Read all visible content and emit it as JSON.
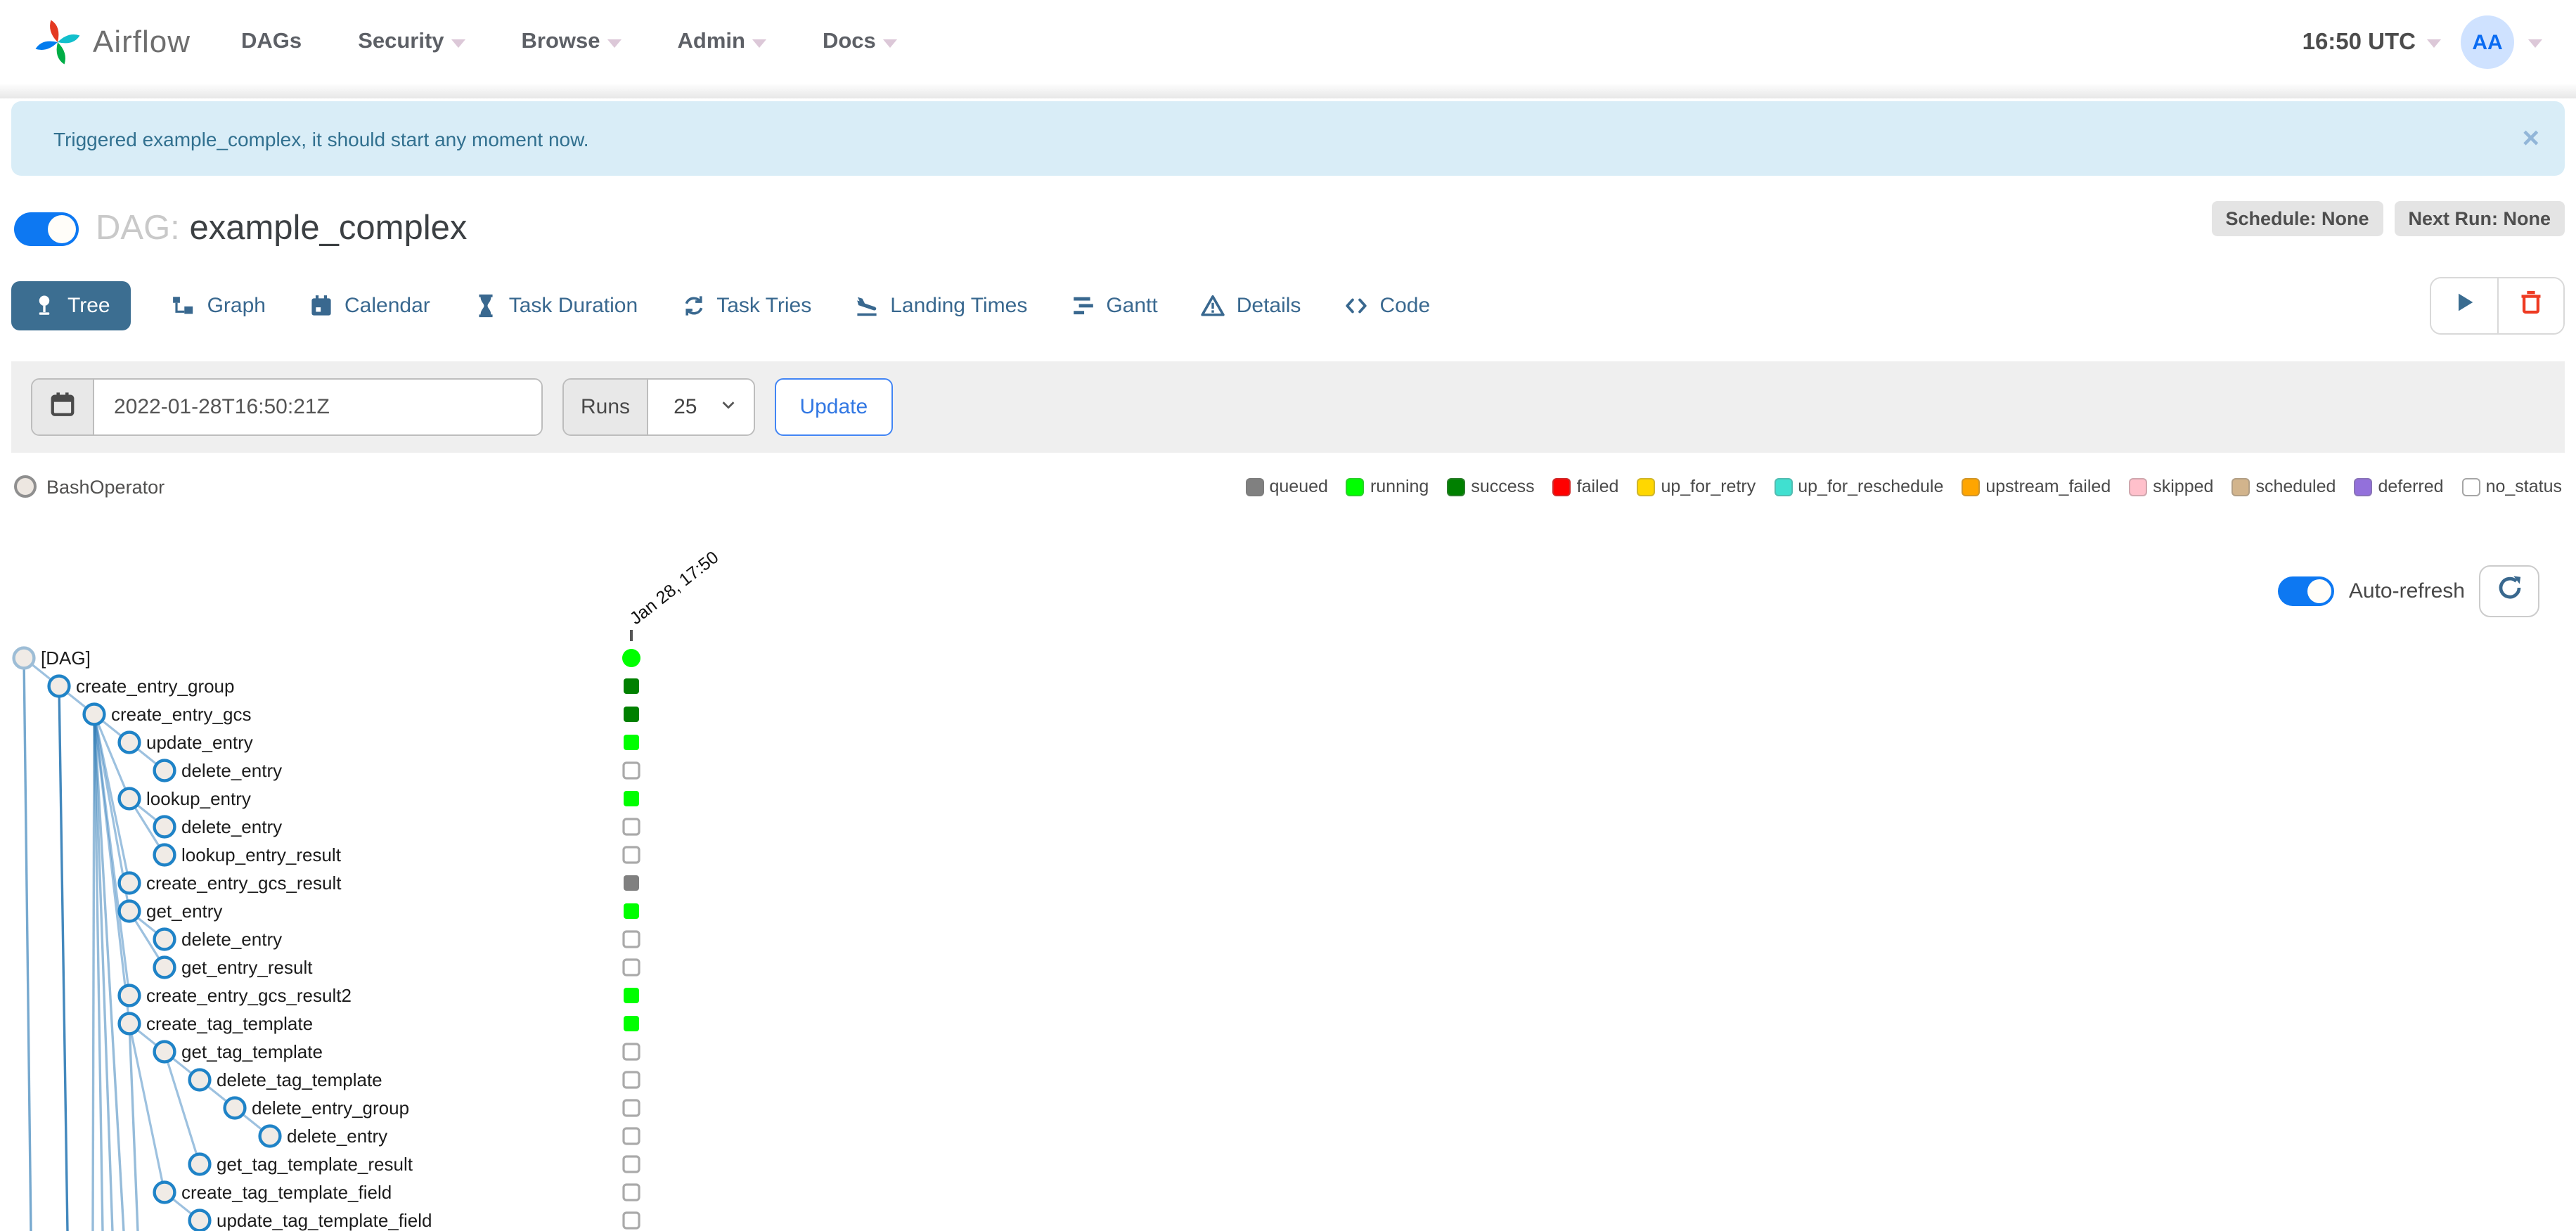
{
  "navbar": {
    "brand": "Airflow",
    "items": [
      {
        "label": "DAGs",
        "caret": false
      },
      {
        "label": "Security",
        "caret": true
      },
      {
        "label": "Browse",
        "caret": true
      },
      {
        "label": "Admin",
        "caret": true
      },
      {
        "label": "Docs",
        "caret": true
      }
    ],
    "clock": "16:50 UTC",
    "avatar_initials": "AA"
  },
  "alert": {
    "message": "Triggered example_complex, it should start any moment now.",
    "close_label": "×"
  },
  "dag": {
    "prefix": "DAG:",
    "name": "example_complex",
    "schedule_badge": "Schedule: None",
    "next_run_badge": "Next Run: None"
  },
  "tabs": [
    {
      "label": "Tree",
      "icon": "tree-icon",
      "active": true
    },
    {
      "label": "Graph",
      "icon": "graph-icon",
      "active": false
    },
    {
      "label": "Calendar",
      "icon": "calendar-icon",
      "active": false
    },
    {
      "label": "Task Duration",
      "icon": "hourglass-icon",
      "active": false
    },
    {
      "label": "Task Tries",
      "icon": "retry-icon",
      "active": false
    },
    {
      "label": "Landing Times",
      "icon": "landing-icon",
      "active": false
    },
    {
      "label": "Gantt",
      "icon": "gantt-icon",
      "active": false
    },
    {
      "label": "Details",
      "icon": "details-icon",
      "active": false
    },
    {
      "label": "Code",
      "icon": "code-icon",
      "active": false
    }
  ],
  "filter": {
    "base_date_value": "2022-01-28T16:50:21Z",
    "runs_label": "Runs",
    "runs_value": "25",
    "update_label": "Update"
  },
  "legend": {
    "operator_label": "BashOperator",
    "statuses": [
      {
        "label": "queued",
        "color": "#808080"
      },
      {
        "label": "running",
        "color": "#00ff00"
      },
      {
        "label": "success",
        "color": "#008000"
      },
      {
        "label": "failed",
        "color": "#ff0000"
      },
      {
        "label": "up_for_retry",
        "color": "#ffd700"
      },
      {
        "label": "up_for_reschedule",
        "color": "#40e0d0"
      },
      {
        "label": "upstream_failed",
        "color": "#ffa500"
      },
      {
        "label": "skipped",
        "color": "#ffc0cb"
      },
      {
        "label": "scheduled",
        "color": "#d2b48c"
      },
      {
        "label": "deferred",
        "color": "#9370db"
      },
      {
        "label": "no_status",
        "color": "#ffffff",
        "border": "#a6a6a6"
      }
    ]
  },
  "autorefresh": {
    "label": "Auto-refresh",
    "on": true
  },
  "runs_header": {
    "date_label": "Jan 28, 17:50"
  },
  "colors": {
    "accent_blue": "#0d78f2",
    "tab_blue": "#3c6e91",
    "alert_bg": "#d9edf7",
    "alert_text": "#31708f",
    "edge_blue": "#3e85c0",
    "trash_red": "#ee3b23"
  },
  "tree": {
    "rows": [
      {
        "name": "[DAG]",
        "depth": 0,
        "status": "running",
        "shape": "circle"
      },
      {
        "name": "create_entry_group",
        "depth": 1,
        "status": "success",
        "shape": "square"
      },
      {
        "name": "create_entry_gcs",
        "depth": 2,
        "status": "success",
        "shape": "square"
      },
      {
        "name": "update_entry",
        "depth": 3,
        "status": "running",
        "shape": "square"
      },
      {
        "name": "delete_entry",
        "depth": 4,
        "status": "no_status",
        "shape": "square"
      },
      {
        "name": "lookup_entry",
        "depth": 3,
        "status": "running",
        "shape": "square"
      },
      {
        "name": "delete_entry",
        "depth": 4,
        "status": "no_status",
        "shape": "square"
      },
      {
        "name": "lookup_entry_result",
        "depth": 4,
        "status": "no_status",
        "shape": "square"
      },
      {
        "name": "create_entry_gcs_result",
        "depth": 3,
        "status": "queued",
        "shape": "square"
      },
      {
        "name": "get_entry",
        "depth": 3,
        "status": "running",
        "shape": "square"
      },
      {
        "name": "delete_entry",
        "depth": 4,
        "status": "no_status",
        "shape": "square"
      },
      {
        "name": "get_entry_result",
        "depth": 4,
        "status": "no_status",
        "shape": "square"
      },
      {
        "name": "create_entry_gcs_result2",
        "depth": 3,
        "status": "running",
        "shape": "square"
      },
      {
        "name": "create_tag_template",
        "depth": 3,
        "status": "running",
        "shape": "square"
      },
      {
        "name": "get_tag_template",
        "depth": 4,
        "status": "no_status",
        "shape": "square"
      },
      {
        "name": "delete_tag_template",
        "depth": 5,
        "status": "no_status",
        "shape": "square"
      },
      {
        "name": "delete_entry_group",
        "depth": 6,
        "status": "no_status",
        "shape": "square"
      },
      {
        "name": "delete_entry",
        "depth": 7,
        "status": "no_status",
        "shape": "square"
      },
      {
        "name": "get_tag_template_result",
        "depth": 5,
        "status": "no_status",
        "shape": "square"
      },
      {
        "name": "create_tag_template_field",
        "depth": 4,
        "status": "no_status",
        "shape": "square"
      },
      {
        "name": "update_tag_template_field",
        "depth": 5,
        "status": "no_status",
        "shape": "square"
      }
    ],
    "edges": [
      [
        0,
        1
      ],
      [
        1,
        2
      ],
      [
        2,
        3
      ],
      [
        3,
        4
      ],
      [
        2,
        5
      ],
      [
        5,
        6
      ],
      [
        5,
        7
      ],
      [
        2,
        8
      ],
      [
        2,
        9
      ],
      [
        9,
        10
      ],
      [
        9,
        11
      ],
      [
        2,
        12
      ],
      [
        2,
        13
      ],
      [
        13,
        14
      ],
      [
        14,
        15
      ],
      [
        15,
        16
      ],
      [
        16,
        17
      ],
      [
        14,
        18
      ],
      [
        13,
        19
      ],
      [
        19,
        20
      ]
    ]
  }
}
